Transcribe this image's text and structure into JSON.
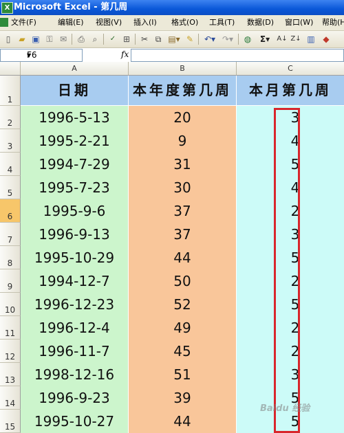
{
  "window": {
    "title": "Microsoft Excel - 第几周"
  },
  "menu": [
    "文件(F)",
    "编辑(E)",
    "视图(V)",
    "插入(I)",
    "格式(O)",
    "工具(T)",
    "数据(D)",
    "窗口(W)",
    "帮助(H)"
  ],
  "toolbar_icons": [
    "new-icon",
    "open-icon",
    "save-icon",
    "permission-icon",
    "email-icon",
    "print-icon",
    "print-preview-icon",
    "spelling-icon",
    "research-icon",
    "cut-icon",
    "copy-icon",
    "paste-icon",
    "format-painter-icon",
    "undo-icon",
    "redo-icon",
    "hyperlink-icon",
    "autosum-icon",
    "sort-ascending-icon",
    "sort-descending-icon",
    "chart-icon"
  ],
  "name_box": "F6",
  "fx_label": "fx",
  "columns": [
    "A",
    "B",
    "C"
  ],
  "headers": {
    "a": "日期",
    "b": "本年度第几周",
    "c": "本月第几周"
  },
  "row_numbers": [
    "1",
    "2",
    "3",
    "4",
    "5",
    "6",
    "7",
    "8",
    "9",
    "10",
    "11",
    "12",
    "13",
    "14",
    "15"
  ],
  "rows": [
    {
      "date": "1996-5-13",
      "year_week": "20",
      "month_week": "3"
    },
    {
      "date": "1995-2-21",
      "year_week": "9",
      "month_week": "4"
    },
    {
      "date": "1994-7-29",
      "year_week": "31",
      "month_week": "5"
    },
    {
      "date": "1995-7-23",
      "year_week": "30",
      "month_week": "4"
    },
    {
      "date": "1995-9-6",
      "year_week": "37",
      "month_week": "2"
    },
    {
      "date": "1996-9-13",
      "year_week": "37",
      "month_week": "3"
    },
    {
      "date": "1995-10-29",
      "year_week": "44",
      "month_week": "5"
    },
    {
      "date": "1994-12-7",
      "year_week": "50",
      "month_week": "2"
    },
    {
      "date": "1996-12-23",
      "year_week": "52",
      "month_week": "5"
    },
    {
      "date": "1996-12-4",
      "year_week": "49",
      "month_week": "2"
    },
    {
      "date": "1996-11-7",
      "year_week": "45",
      "month_week": "2"
    },
    {
      "date": "1998-12-16",
      "year_week": "51",
      "month_week": "3"
    },
    {
      "date": "1996-9-23",
      "year_week": "39",
      "month_week": "5"
    },
    {
      "date": "1995-10-27",
      "year_week": "44",
      "month_week": "5"
    }
  ],
  "selected_row": "6",
  "watermark": "Baidu 经验",
  "colors": {
    "date_col": "#ccf5cc",
    "year_week_col": "#f9c69a",
    "month_week_col": "#ccfbf8",
    "header_row": "#a8ccf0",
    "highlight_box": "#d8262c"
  }
}
